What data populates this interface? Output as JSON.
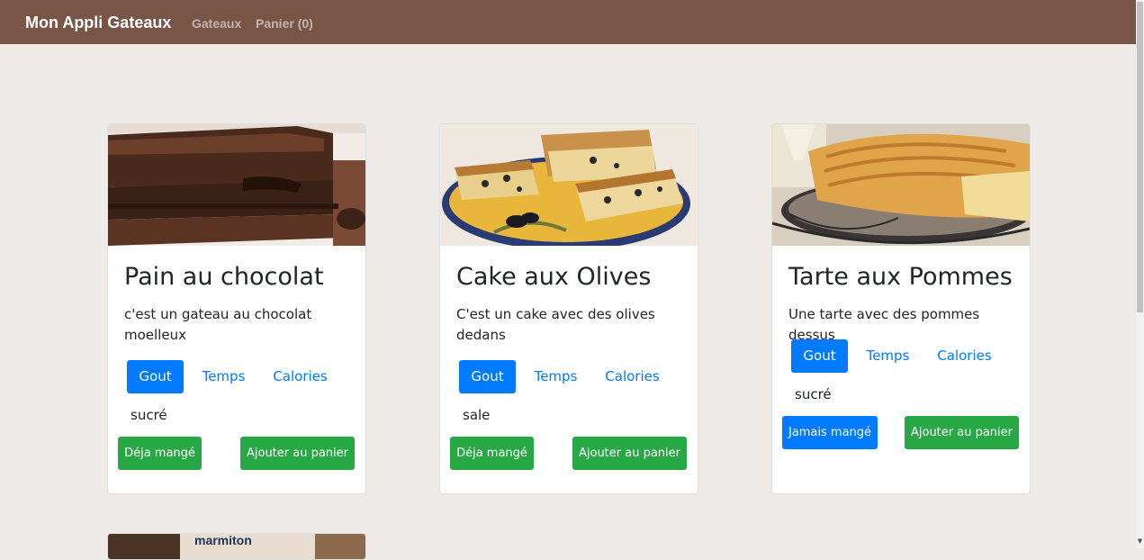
{
  "nav": {
    "brand": "Mon Appli Gateaux",
    "links": [
      "Gateaux",
      "Panier (0)"
    ]
  },
  "cards": [
    {
      "title": "Pain au chocolat",
      "description": "c'est un gateau au chocolat moelleux",
      "tabs": [
        "Gout",
        "Temps",
        "Calories"
      ],
      "active_tab": "Gout",
      "tab_value": "sucré",
      "eaten_button": "Déja mangé",
      "cart_button": "Ajouter au panier"
    },
    {
      "title": "Cake aux Olives",
      "description": "C'est un cake avec des olives dedans",
      "tabs": [
        "Gout",
        "Temps",
        "Calories"
      ],
      "active_tab": "Gout",
      "tab_value": "sale",
      "eaten_button": "Déja mangé",
      "cart_button": "Ajouter au panier"
    },
    {
      "title": "Tarte aux Pommes",
      "description": "Une tarte avec des pommes dessus",
      "tabs": [
        "Gout",
        "Temps",
        "Calories"
      ],
      "active_tab": "Gout",
      "tab_value": "sucré",
      "eaten_button": "Jamais mangé",
      "cart_button": "Ajouter au panier"
    }
  ],
  "partial_card": {
    "image_text": "marmiton"
  },
  "colors": {
    "navbar": "#795548",
    "page_background": "#eeeae7",
    "primary": "#007bff",
    "success": "#28a745"
  }
}
